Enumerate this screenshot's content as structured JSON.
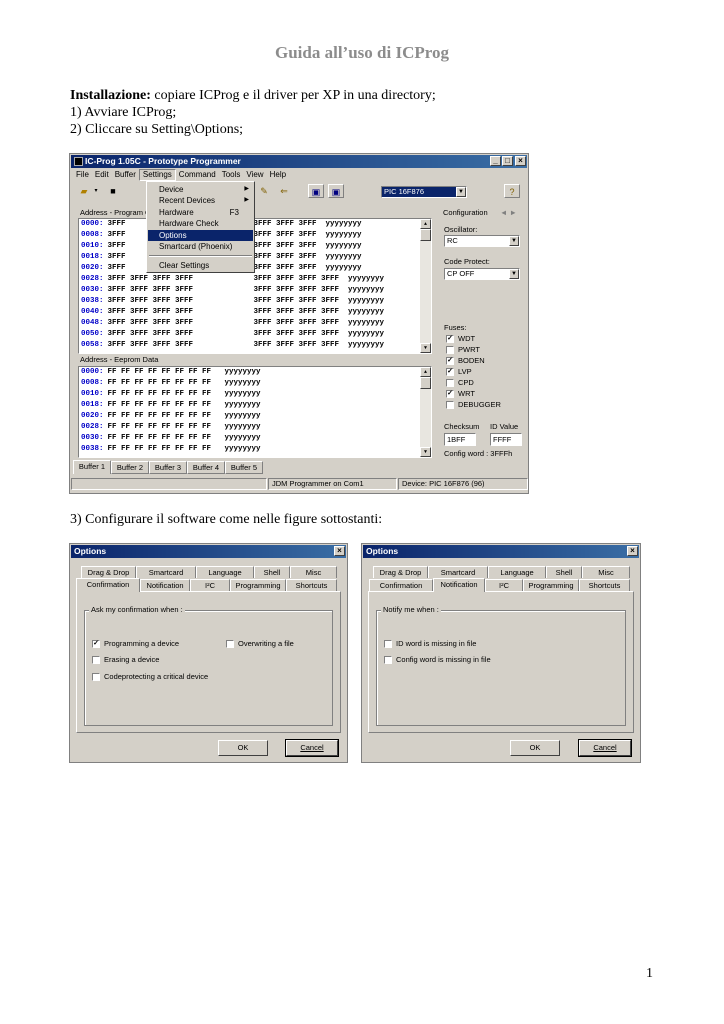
{
  "doc": {
    "title": "Guida all’uso di ICProg",
    "install_label": "Installazione:",
    "install_text": " copiare ICProg e il driver per XP in una directory;",
    "step1": "1) Avviare ICProg;",
    "step2": "2) Cliccare su Setting\\Options;",
    "step3": "3) Configurare il software come nelle figure sottostanti:",
    "page_number": "1"
  },
  "icprog": {
    "title": "IC-Prog 1.05C - Prototype Programmer",
    "title_buttons": [
      "_",
      "□",
      "×"
    ],
    "menu": [
      "File",
      "Edit",
      "Buffer",
      "Settings",
      "Command",
      "Tools",
      "View",
      "Help"
    ],
    "device_combo": "PIC 16F876",
    "address_program_label": "Address - Program Code",
    "address_eeprom_label": "Address - Eeprom Data",
    "program_rows": [
      {
        "addr": "0000:",
        "left": "3FFF",
        "right": "3FFF 3FFF 3FFF  yyyyyyyy"
      },
      {
        "addr": "0008:",
        "left": "3FFF",
        "right": "3FFF 3FFF 3FFF  yyyyyyyy"
      },
      {
        "addr": "0010:",
        "left": "3FFF",
        "right": "3FFF 3FFF 3FFF  yyyyyyyy"
      },
      {
        "addr": "0018:",
        "left": "3FFF",
        "right": "3FFF 3FFF 3FFF  yyyyyyyy"
      },
      {
        "addr": "0020:",
        "left": "3FFF",
        "right": "3FFF 3FFF 3FFF  yyyyyyyy"
      },
      {
        "addr": "0028:",
        "left": "3FFF 3FFF 3FFF 3FFF",
        "right": "3FFF 3FFF 3FFF 3FFF  yyyyyyyy"
      },
      {
        "addr": "0030:",
        "left": "3FFF 3FFF 3FFF 3FFF",
        "right": "3FFF 3FFF 3FFF 3FFF  yyyyyyyy"
      },
      {
        "addr": "0038:",
        "left": "3FFF 3FFF 3FFF 3FFF",
        "right": "3FFF 3FFF 3FFF 3FFF  yyyyyyyy"
      },
      {
        "addr": "0040:",
        "left": "3FFF 3FFF 3FFF 3FFF",
        "right": "3FFF 3FFF 3FFF 3FFF  yyyyyyyy"
      },
      {
        "addr": "0048:",
        "left": "3FFF 3FFF 3FFF 3FFF",
        "right": "3FFF 3FFF 3FFF 3FFF  yyyyyyyy"
      },
      {
        "addr": "0050:",
        "left": "3FFF 3FFF 3FFF 3FFF",
        "right": "3FFF 3FFF 3FFF 3FFF  yyyyyyyy"
      },
      {
        "addr": "0058:",
        "left": "3FFF 3FFF 3FFF 3FFF",
        "right": "3FFF 3FFF 3FFF 3FFF  yyyyyyyy"
      }
    ],
    "eeprom_rows": [
      {
        "addr": "0000:",
        "data": "FF FF FF FF FF FF FF FF   yyyyyyyy"
      },
      {
        "addr": "0008:",
        "data": "FF FF FF FF FF FF FF FF   yyyyyyyy"
      },
      {
        "addr": "0010:",
        "data": "FF FF FF FF FF FF FF FF   yyyyyyyy"
      },
      {
        "addr": "0018:",
        "data": "FF FF FF FF FF FF FF FF   yyyyyyyy"
      },
      {
        "addr": "0020:",
        "data": "FF FF FF FF FF FF FF FF   yyyyyyyy"
      },
      {
        "addr": "0028:",
        "data": "FF FF FF FF FF FF FF FF   yyyyyyyy"
      },
      {
        "addr": "0030:",
        "data": "FF FF FF FF FF FF FF FF   yyyyyyyy"
      },
      {
        "addr": "0038:",
        "data": "FF FF FF FF FF FF FF FF   yyyyyyyy"
      }
    ],
    "settings_menu": [
      {
        "label": "Device",
        "shortcut": "",
        "submenu": true,
        "selected": false
      },
      {
        "label": "Recent Devices",
        "shortcut": "",
        "submenu": true,
        "selected": false
      },
      {
        "label": "Hardware",
        "shortcut": "F3",
        "submenu": false,
        "selected": false
      },
      {
        "label": "Hardware Check",
        "shortcut": "",
        "submenu": false,
        "selected": false
      },
      {
        "label": "Options",
        "shortcut": "",
        "submenu": false,
        "selected": true
      },
      {
        "label": "Smartcard (Phoenix)",
        "shortcut": "",
        "submenu": false,
        "selected": false
      },
      {
        "label": "Clear Settings",
        "shortcut": "",
        "submenu": false,
        "selected": false
      }
    ],
    "config": {
      "header": "Configuration",
      "nav": "◄ ►",
      "oscillator_label": "Oscillator:",
      "oscillator_value": "RC",
      "code_protect_label": "Code Protect:",
      "code_protect_value": "CP OFF",
      "fuses_label": "Fuses:",
      "fuses": [
        {
          "name": "WDT",
          "checked": true
        },
        {
          "name": "PWRT",
          "checked": false
        },
        {
          "name": "BODEN",
          "checked": true
        },
        {
          "name": "LVP",
          "checked": true
        },
        {
          "name": "CPD",
          "checked": false
        },
        {
          "name": "WRT",
          "checked": true
        },
        {
          "name": "DEBUGGER",
          "checked": false
        }
      ],
      "checksum_label": "Checksum",
      "checksum_value": "1BFF",
      "id_label": "ID Value",
      "id_value": "FFFF",
      "config_word": "Config word : 3FFFh"
    },
    "buffer_tabs": [
      "Buffer 1",
      "Buffer 2",
      "Buffer 3",
      "Buffer 4",
      "Buffer 5"
    ],
    "status": [
      "",
      "JDM Programmer on Com1",
      "Device: PIC 16F876  (96)"
    ]
  },
  "options_common": {
    "title": "Options",
    "close": "×",
    "tabs_row1": [
      "Drag & Drop",
      "Smartcard",
      "Language",
      "Shell",
      "Misc"
    ],
    "tabs_row2": [
      "Confirmation",
      "Notification",
      "I²C",
      "Programming",
      "Shortcuts"
    ],
    "ok": "OK",
    "cancel": "Cancel"
  },
  "options1": {
    "group_title": "Ask my confirmation when :",
    "checks": [
      {
        "label": "Programming a device",
        "checked": true
      },
      {
        "label": "Overwriting a file",
        "checked": false
      },
      {
        "label": "Erasing a device",
        "checked": false
      },
      {
        "label": "Codeprotecting a critical device",
        "checked": false
      }
    ]
  },
  "options2": {
    "group_title": "Notify me when :",
    "checks": [
      {
        "label": "ID word is missing in file",
        "checked": false
      },
      {
        "label": "Config word is missing in file",
        "checked": false
      }
    ]
  }
}
